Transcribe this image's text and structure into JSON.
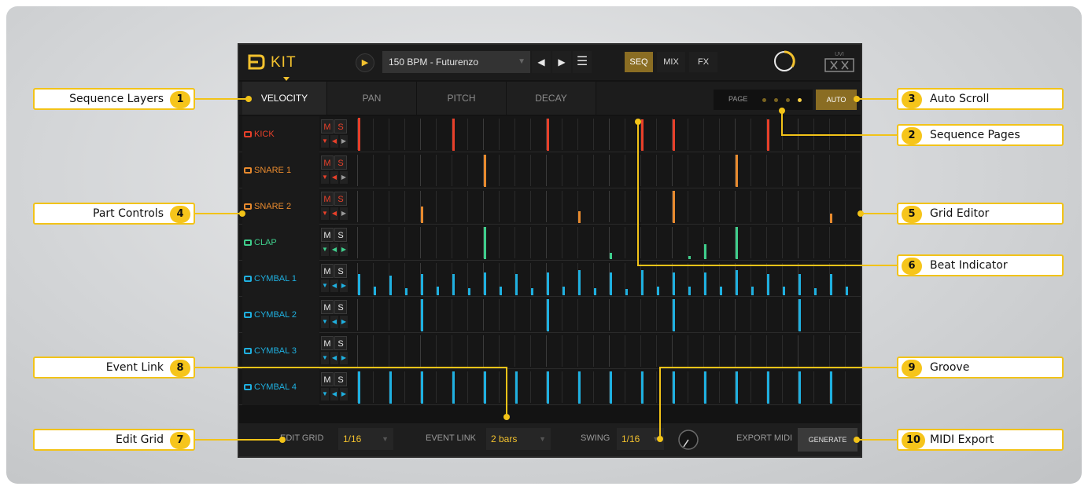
{
  "app": {
    "title": "KIT",
    "preset": "150 BPM - Futurenzo",
    "modes": [
      "SEQ",
      "MIX",
      "FX"
    ],
    "active_mode": "SEQ",
    "logo_text": "UVI"
  },
  "layers": {
    "tabs": [
      "VELOCITY",
      "PAN",
      "PITCH",
      "DECAY"
    ],
    "active": "VELOCITY",
    "page_label": "PAGE",
    "pages": 4,
    "current_page": 4,
    "auto_label": "AUTO"
  },
  "tracks": [
    {
      "name": "KICK",
      "color": "#e8402a",
      "steps": [
        {
          "i": 0,
          "v": 1.0
        },
        {
          "i": 6,
          "v": 0.97
        },
        {
          "i": 12,
          "v": 0.97
        },
        {
          "i": 18,
          "v": 0.95
        },
        {
          "i": 20,
          "v": 0.95
        },
        {
          "i": 26,
          "v": 0.95
        }
      ]
    },
    {
      "name": "SNARE 1",
      "color": "#e88a2e",
      "steps": [
        {
          "i": 8,
          "v": 0.97
        },
        {
          "i": 24,
          "v": 0.97
        }
      ]
    },
    {
      "name": "SNARE 2",
      "color": "#e88a2e",
      "steps": [
        {
          "i": 4,
          "v": 0.5
        },
        {
          "i": 14,
          "v": 0.35
        },
        {
          "i": 20,
          "v": 0.97
        },
        {
          "i": 30,
          "v": 0.28
        }
      ]
    },
    {
      "name": "CLAP",
      "color": "#3fce8c",
      "steps": [
        {
          "i": 8,
          "v": 0.97
        },
        {
          "i": 16,
          "v": 0.2
        },
        {
          "i": 21,
          "v": 0.1
        },
        {
          "i": 22,
          "v": 0.45
        },
        {
          "i": 24,
          "v": 0.97
        }
      ]
    },
    {
      "name": "CYMBAL 1",
      "color": "#1fb0e0",
      "steps": [
        {
          "i": 0,
          "v": 0.65
        },
        {
          "i": 1,
          "v": 0.25
        },
        {
          "i": 2,
          "v": 0.6
        },
        {
          "i": 3,
          "v": 0.22
        },
        {
          "i": 4,
          "v": 0.65
        },
        {
          "i": 5,
          "v": 0.25
        },
        {
          "i": 6,
          "v": 0.65
        },
        {
          "i": 7,
          "v": 0.22
        },
        {
          "i": 8,
          "v": 0.7
        },
        {
          "i": 9,
          "v": 0.25
        },
        {
          "i": 10,
          "v": 0.65
        },
        {
          "i": 11,
          "v": 0.22
        },
        {
          "i": 12,
          "v": 0.7
        },
        {
          "i": 13,
          "v": 0.25
        },
        {
          "i": 14,
          "v": 0.75
        },
        {
          "i": 15,
          "v": 0.22
        },
        {
          "i": 16,
          "v": 0.7
        },
        {
          "i": 17,
          "v": 0.2
        },
        {
          "i": 18,
          "v": 0.75
        },
        {
          "i": 19,
          "v": 0.25
        },
        {
          "i": 20,
          "v": 0.7
        },
        {
          "i": 21,
          "v": 0.25
        },
        {
          "i": 22,
          "v": 0.7
        },
        {
          "i": 23,
          "v": 0.25
        },
        {
          "i": 24,
          "v": 0.75
        },
        {
          "i": 25,
          "v": 0.25
        },
        {
          "i": 26,
          "v": 0.65
        },
        {
          "i": 27,
          "v": 0.25
        },
        {
          "i": 28,
          "v": 0.65
        },
        {
          "i": 29,
          "v": 0.22
        },
        {
          "i": 30,
          "v": 0.65
        },
        {
          "i": 31,
          "v": 0.25
        }
      ]
    },
    {
      "name": "CYMBAL 2",
      "color": "#1fb0e0",
      "steps": [
        {
          "i": 4,
          "v": 0.97
        },
        {
          "i": 12,
          "v": 0.97
        },
        {
          "i": 20,
          "v": 0.97
        },
        {
          "i": 28,
          "v": 0.97
        }
      ]
    },
    {
      "name": "CYMBAL 3",
      "color": "#1fb0e0",
      "steps": []
    },
    {
      "name": "CYMBAL 4",
      "color": "#1fb0e0",
      "steps": [
        {
          "i": 0,
          "v": 0.97
        },
        {
          "i": 2,
          "v": 0.97
        },
        {
          "i": 4,
          "v": 0.97
        },
        {
          "i": 6,
          "v": 0.97
        },
        {
          "i": 8,
          "v": 0.97
        },
        {
          "i": 10,
          "v": 0.97
        },
        {
          "i": 12,
          "v": 0.97
        },
        {
          "i": 14,
          "v": 0.97
        },
        {
          "i": 16,
          "v": 0.97
        },
        {
          "i": 18,
          "v": 0.97
        },
        {
          "i": 20,
          "v": 0.97
        },
        {
          "i": 22,
          "v": 0.97
        },
        {
          "i": 24,
          "v": 0.97
        },
        {
          "i": 26,
          "v": 0.97
        },
        {
          "i": 28,
          "v": 0.97
        },
        {
          "i": 30,
          "v": 0.97
        }
      ]
    }
  ],
  "track_buttons": {
    "mute": "M",
    "solo": "S"
  },
  "steps_per_page": 32,
  "bottom": {
    "edit_grid_label": "EDIT GRID",
    "edit_grid_value": "1/16",
    "event_link_label": "EVENT LINK",
    "event_link_value": "2 bars",
    "swing_label": "SWING",
    "swing_value": "1/16",
    "export_label": "EXPORT MIDI",
    "generate_label": "GENERATE"
  },
  "callouts": {
    "c1": {
      "num": "1",
      "label": "Sequence Layers"
    },
    "c2": {
      "num": "2",
      "label": "Sequence Pages"
    },
    "c3": {
      "num": "3",
      "label": "Auto Scroll"
    },
    "c4": {
      "num": "4",
      "label": "Part Controls"
    },
    "c5": {
      "num": "5",
      "label": "Grid Editor"
    },
    "c6": {
      "num": "6",
      "label": "Beat Indicator"
    },
    "c7": {
      "num": "7",
      "label": "Edit Grid"
    },
    "c8": {
      "num": "8",
      "label": "Event Link"
    },
    "c9": {
      "num": "9",
      "label": "Groove"
    },
    "c10": {
      "num": "10",
      "label": "MIDI Export"
    }
  },
  "colors": {
    "accent": "#f2c12e",
    "callout": "#f2c318"
  }
}
